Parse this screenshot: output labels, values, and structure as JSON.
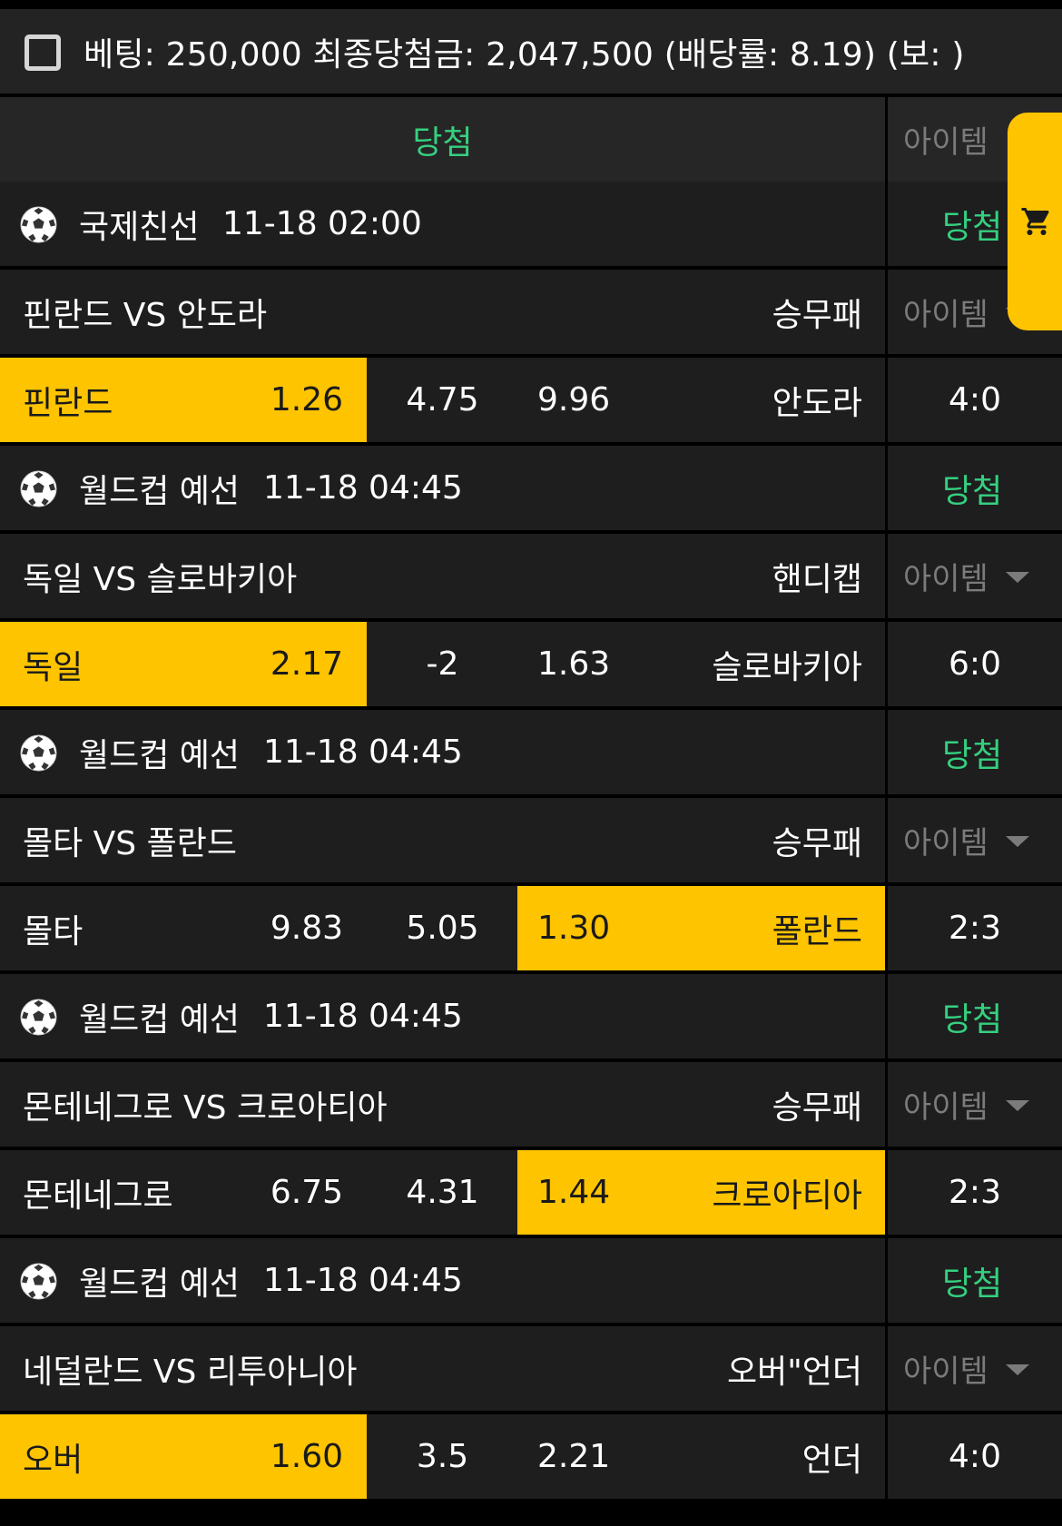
{
  "header": {
    "summary": "베팅: 250,000 최종당첨금: 2,047,500 (배당률: 8.19) (보: )",
    "result_label": "당첨",
    "item_label": "아이템"
  },
  "colors": {
    "accent_yellow": "#ffc400",
    "win_green": "#35d07f",
    "row_bg": "#1e1e1f"
  },
  "games": [
    {
      "league": "국제친선",
      "time": "11-18 02:00",
      "result": "당첨",
      "match": "핀란드 VS 안도라",
      "type": "승무패",
      "item_label": "아이템",
      "home": "핀란드",
      "home_odds": "1.26",
      "mid": "4.75",
      "away_odds": "9.96",
      "away": "안도라",
      "score": "4:0",
      "selected": "home"
    },
    {
      "league": "월드컵 예선",
      "time": "11-18 04:45",
      "result": "당첨",
      "match": "독일 VS 슬로바키아",
      "type": "핸디캡",
      "item_label": "아이템",
      "home": "독일",
      "home_odds": "2.17",
      "mid": "-2",
      "away_odds": "1.63",
      "away": "슬로바키아",
      "score": "6:0",
      "selected": "home"
    },
    {
      "league": "월드컵 예선",
      "time": "11-18 04:45",
      "result": "당첨",
      "match": "몰타 VS 폴란드",
      "type": "승무패",
      "item_label": "아이템",
      "home": "몰타",
      "home_odds": "9.83",
      "mid": "5.05",
      "away_odds": "1.30",
      "away": "폴란드",
      "score": "2:3",
      "selected": "away"
    },
    {
      "league": "월드컵 예선",
      "time": "11-18 04:45",
      "result": "당첨",
      "match": "몬테네그로 VS 크로아티아",
      "type": "승무패",
      "item_label": "아이템",
      "home": "몬테네그로",
      "home_odds": "6.75",
      "mid": "4.31",
      "away_odds": "1.44",
      "away": "크로아티아",
      "score": "2:3",
      "selected": "away"
    },
    {
      "league": "월드컵 예선",
      "time": "11-18 04:45",
      "result": "당첨",
      "match": "네덜란드 VS 리투아니아",
      "type": "오버\"언더",
      "item_label": "아이템",
      "home": "오버",
      "home_odds": "1.60",
      "mid": "3.5",
      "away_odds": "2.21",
      "away": "언더",
      "score": "4:0",
      "selected": "home"
    }
  ]
}
